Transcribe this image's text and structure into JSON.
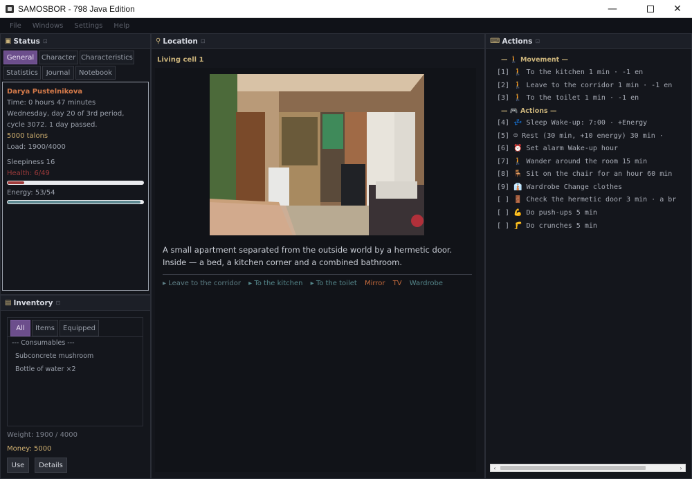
{
  "window": {
    "title": "SAMOSBOR - 798 Java Edition"
  },
  "menu": [
    "File",
    "Windows",
    "Settings",
    "Help"
  ],
  "status": {
    "title": "Status",
    "tabs": [
      "General",
      "Character",
      "Characteristics",
      "Statistics",
      "Journal",
      "Notebook"
    ],
    "name": "Darya Pustelnikova",
    "time": "Time: 0 hours 47 minutes",
    "date1": "Wednesday, day 20 of 3rd period,",
    "date2": "cycle 3072. 1 day passed.",
    "money": "5000 talons",
    "load": "Load: 1900/4000",
    "sleepiness": "Sleepiness 16",
    "health_label": "Health: 6/49",
    "health_value": 6,
    "health_max": 49,
    "health_color": "#a03b3b",
    "energy_label": "Energy: 53/54",
    "energy_value": 53,
    "energy_max": 54,
    "energy_color": "#5f8a92"
  },
  "inventory": {
    "title": "Inventory",
    "tabs": [
      "All",
      "Items",
      "Equipped"
    ],
    "items": [
      "--- Consumables ---",
      "Subconcrete mushroom",
      "Bottle of water ×2"
    ],
    "weight": "Weight: 1900 / 4000",
    "money": "Money: 5000",
    "use_label": "Use",
    "details_label": "Details"
  },
  "location": {
    "title": "Location",
    "name": "Living cell 1",
    "description": "A small apartment separated from the outside world by a hermetic door. Inside — a bed, a kitchen corner and a combined bathroom.",
    "links": [
      "▸ Leave to the corridor",
      "▸ To the kitchen",
      "▸ To the toilet",
      "Mirror",
      "TV",
      "Wardrobe"
    ]
  },
  "actions": {
    "title": "Actions",
    "movement_header": "— 🚶 Movement —",
    "actions_header": "— 🎮 Actions —",
    "items": [
      "[1] 🚶 To the kitchen  1 min · -1 en",
      "[2] 🚶 Leave to the corridor  1 min · -1 en",
      "[3] 🚶 To the toilet  1 min · -1 en",
      "[4] 💤 Sleep  Wake-up: 7:00 · +Energy",
      "[5] ☺ Rest (30 min, +10 energy)  30 min ·",
      "[6] ⏰ Set alarm  Wake-up hour",
      "[7] 🚶 Wander around the room  15 min",
      "[8] 🪑 Sit on the chair for an hour  60 min",
      "[9] 👔 Wardrobe  Change clothes",
      "[ ] 🚪 Check the hermetic door  3 min · a br",
      "[ ] 💪 Do push-ups  5 min",
      "[ ] 🦵 Do crunches  5 min"
    ]
  }
}
